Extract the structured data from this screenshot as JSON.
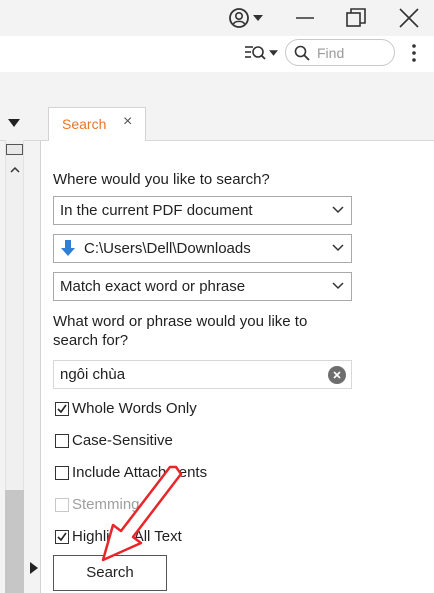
{
  "toolbar": {
    "find_placeholder": "Find"
  },
  "tab": {
    "label": "Search",
    "close": "×"
  },
  "search_panel": {
    "where_label": "Where would you like to search?",
    "scope_value": "In the current PDF document",
    "path_value": "C:\\Users\\Dell\\Downloads",
    "match_value": "Match exact word or phrase",
    "phrase_label_line1": "What word or phrase would you like to",
    "phrase_label_line2": "search for?",
    "query_value": "ngôi chùa",
    "options": [
      {
        "label": "Whole Words Only",
        "checked": true,
        "enabled": true
      },
      {
        "label": "Case-Sensitive",
        "checked": false,
        "enabled": true
      },
      {
        "label": "Include Attachments",
        "checked": false,
        "enabled": true
      },
      {
        "label": "Stemming",
        "checked": false,
        "enabled": false
      },
      {
        "label": "Highlight All Text",
        "checked": true,
        "enabled": true
      }
    ],
    "search_button": "Search"
  },
  "colors": {
    "accent": "#e8762b",
    "annotation": "#e8262a",
    "path_icon": "#2f7fd6"
  },
  "icons": [
    "account-icon",
    "minimize-icon",
    "restore-icon",
    "close-icon",
    "search-tools-icon",
    "search-icon",
    "more-icon",
    "collapse-arrow-icon",
    "folder-down-arrow-icon",
    "clear-icon",
    "expand-arrow-icon"
  ]
}
